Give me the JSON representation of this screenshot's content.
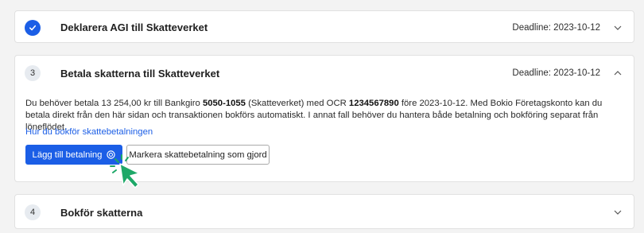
{
  "steps": [
    {
      "number": "",
      "title": "Deklarera AGI till Skatteverket",
      "deadline": "Deadline: 2023-10-12",
      "status": "done"
    },
    {
      "number": "3",
      "title": "Betala skatterna till Skatteverket",
      "deadline": "Deadline: 2023-10-12",
      "status": "expanded",
      "description": {
        "part1": "Du behöver betala 13 254,00 kr till Bankgiro ",
        "bankgiro": "5050-1055",
        "part2": " (Skatteverket) med OCR ",
        "ocr": "1234567890",
        "part3": " före 2023-10-12. Med Bokio Företagskonto kan du betala direkt från den här sidan och transaktionen bokförs automatiskt. I annat fall behöver du hantera både betalning och bokföring separat från löneflödet."
      },
      "help_link": "Hur du bokför skattebetalningen",
      "primary_button": "Lägg till betalning",
      "secondary_button": "Markera skattebetalning som gjord"
    },
    {
      "number": "4",
      "title": "Bokför skatterna",
      "deadline": "",
      "status": "pending"
    }
  ],
  "colors": {
    "accent": "#1b5ee6",
    "cursor": "#1ea868",
    "background": "#f3f3f3"
  },
  "icons": {
    "done": "checkmark-icon",
    "chevron_down": "chevron-down-icon",
    "chevron_up": "chevron-up-icon",
    "coin": "coin-icon",
    "cursor": "pointer-cursor-icon"
  }
}
